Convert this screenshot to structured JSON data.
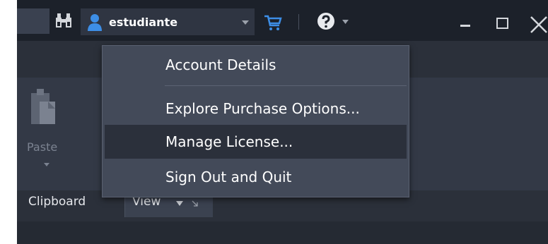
{
  "titlebar": {
    "user_name": "estudiante"
  },
  "menu": {
    "items": [
      {
        "label": "Account Details"
      },
      {
        "label": "Explore Purchase Options..."
      },
      {
        "label": "Manage License..."
      },
      {
        "label": "Sign Out and Quit"
      }
    ],
    "highlighted_index": 2
  },
  "ribbon": {
    "paste_label": "Paste",
    "clipboard_group_label": "Clipboard",
    "view_label": "View"
  },
  "icons": {
    "binoculars": "binoculars-icon",
    "user": "user-icon",
    "cart": "cart-icon",
    "help": "help-icon",
    "paste": "paste-icon"
  },
  "colors": {
    "user_icon": "#3d8ee6",
    "cart_icon": "#3d8ee6",
    "menu_bg": "#434a59",
    "menu_highlight": "#2b303b"
  }
}
